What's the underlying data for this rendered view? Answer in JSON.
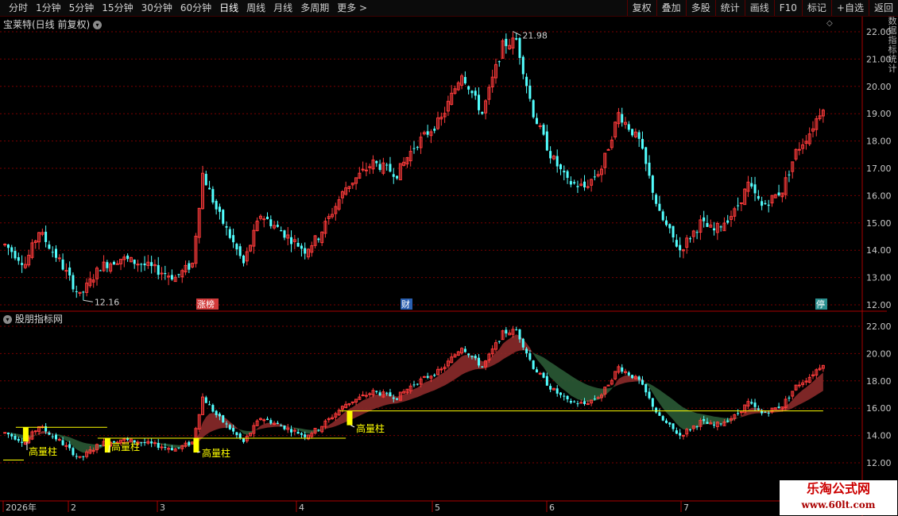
{
  "toolbar": {
    "periods": [
      "分时",
      "1分钟",
      "5分钟",
      "15分钟",
      "30分钟",
      "60分钟",
      "日线",
      "周线",
      "月线",
      "多周期",
      "更多 >"
    ],
    "active_period": "日线",
    "buttons": [
      "复权",
      "叠加",
      "多股",
      "统计",
      "画线",
      "F10",
      "标记",
      "+自选",
      "返回"
    ]
  },
  "main_chart": {
    "title": "宝莱特(日线 前复权)",
    "y_ticks": [
      "22.00",
      "21.00",
      "20.00",
      "19.00",
      "18.00",
      "17.00",
      "16.00",
      "15.00",
      "14.00",
      "13.00",
      "12.00"
    ],
    "high_label": "21.98",
    "low_label": "12.16",
    "markers": [
      {
        "text": "涨榜",
        "color": "#d23a3a"
      },
      {
        "text": "财",
        "color": "#2a5fb0"
      },
      {
        "text": "停",
        "color": "#2a8f8f"
      }
    ]
  },
  "indicator_chart": {
    "title": "股朋指标网",
    "y_ticks": [
      "22.00",
      "20.00",
      "18.00",
      "16.00",
      "14.00",
      "12.00"
    ],
    "volume_label": "高量柱"
  },
  "x_axis": {
    "labels": [
      "2026年",
      "2",
      "3",
      "4",
      "5",
      "6",
      "7"
    ]
  },
  "side_strip": {
    "text": "数据指标统计"
  },
  "watermark": {
    "name": "乐淘公式网",
    "url": "www.60lt.com"
  },
  "colors": {
    "up": "#ff3b3b",
    "down": "#52ffff",
    "grid": "#7a0000",
    "support_line": "#ffff00",
    "band_up": "#8b2a2a",
    "band_down": "#2a5a35"
  }
}
